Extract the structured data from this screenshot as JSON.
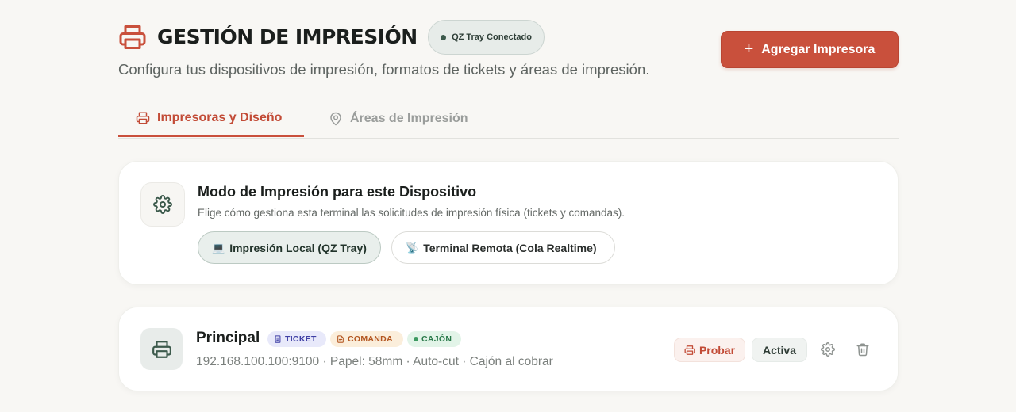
{
  "header": {
    "title": "GESTIÓN DE IMPRESIÓN",
    "status": "QZ Tray Conectado",
    "subtitle": "Configura tus dispositivos de impresión, formatos de tickets y áreas de impresión.",
    "add_button": "Agregar Impresora",
    "icon": "printer-icon"
  },
  "tabs": [
    {
      "label": "Impresoras y Diseño",
      "icon": "printer-icon",
      "active": true
    },
    {
      "label": "Áreas de Impresión",
      "icon": "map-pin-icon",
      "active": false
    }
  ],
  "print_mode": {
    "title": "Modo de Impresión para este Dispositivo",
    "description": "Elige cómo gestiona esta terminal las solicitudes de impresión física (tickets y comandas).",
    "options": [
      {
        "emoji": "💻",
        "label": "Impresión Local (QZ Tray)",
        "selected": true
      },
      {
        "emoji": "📡",
        "label": "Terminal Remota (Cola Realtime)",
        "selected": false
      }
    ],
    "icon": "gear-icon"
  },
  "printers": [
    {
      "name": "Principal",
      "badges": [
        "TICKET",
        "COMANDA",
        "CAJÓN"
      ],
      "info": "192.168.100.100:9100 · Papel: 58mm · Auto-cut · Cajón al cobrar",
      "test_label": "Probar",
      "status_label": "Activa"
    }
  ],
  "colors": {
    "accent": "#c9503c",
    "background": "#f8f7f4",
    "status_dot": "#3c5a4c"
  }
}
